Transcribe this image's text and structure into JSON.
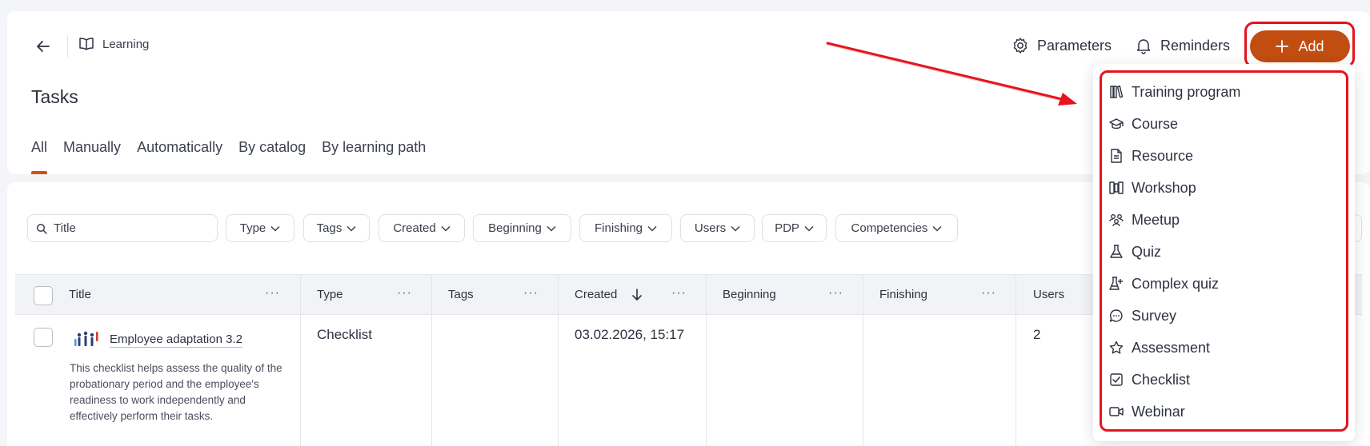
{
  "header": {
    "breadcrumb": "Learning",
    "page_title": "Tasks",
    "parameters_label": "Parameters",
    "reminders_label": "Reminders",
    "add_label": "Add"
  },
  "tabs": [
    {
      "label": "All",
      "active": true
    },
    {
      "label": "Manually"
    },
    {
      "label": "Automatically"
    },
    {
      "label": "By catalog"
    },
    {
      "label": "By learning path"
    }
  ],
  "filters": {
    "search_placeholder": "Title",
    "items": [
      "Type",
      "Tags",
      "Created",
      "Beginning",
      "Finishing",
      "Users",
      "PDP",
      "Competencies"
    ]
  },
  "table": {
    "columns": [
      "Title",
      "Type",
      "Tags",
      "Created",
      "Beginning",
      "Finishing",
      "Users"
    ],
    "rows": [
      {
        "title": "Employee adaptation 3.2",
        "description": "This checklist helps assess the quality of the probationary period and the employee's readiness to work independently and effectively perform their tasks.",
        "type": "Checklist",
        "tags": "",
        "created": "03.02.2026, 15:17",
        "beginning": "",
        "finishing": "",
        "users": "2"
      }
    ]
  },
  "add_menu": {
    "items": [
      {
        "label": "Training program",
        "icon": "books-icon"
      },
      {
        "label": "Course",
        "icon": "graduation-cap-icon"
      },
      {
        "label": "Resource",
        "icon": "document-icon"
      },
      {
        "label": "Workshop",
        "icon": "workshop-icon"
      },
      {
        "label": "Meetup",
        "icon": "people-icon"
      },
      {
        "label": "Quiz",
        "icon": "flask-icon"
      },
      {
        "label": "Complex quiz",
        "icon": "flask-plus-icon"
      },
      {
        "label": "Survey",
        "icon": "chat-bubble-icon"
      },
      {
        "label": "Assessment",
        "icon": "star-icon"
      },
      {
        "label": "Checklist",
        "icon": "checkbox-icon"
      },
      {
        "label": "Webinar",
        "icon": "video-icon"
      }
    ]
  },
  "colors": {
    "accent": "#c14d10",
    "highlight": "#e5131c"
  }
}
